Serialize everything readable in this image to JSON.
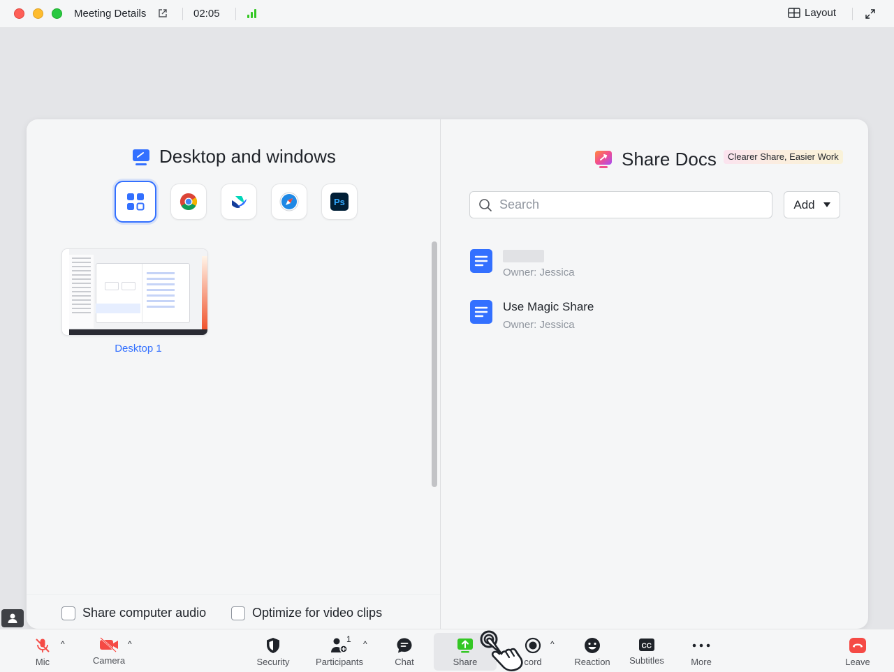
{
  "titlebar": {
    "meeting_title": "Meeting Details",
    "timer": "02:05",
    "layout_label": "Layout"
  },
  "left_panel": {
    "title": "Desktop and windows",
    "apps": [
      "all-windows-icon",
      "chrome-icon",
      "feishu-icon",
      "safari-icon",
      "photoshop-icon"
    ],
    "desktop_label": "Desktop 1",
    "share_audio_label": "Share computer audio",
    "optimize_video_label": "Optimize for video clips"
  },
  "right_panel": {
    "title": "Share Docs",
    "tagline": "Clearer Share, Easier Work",
    "search_placeholder": "Search",
    "add_label": "Add",
    "docs": [
      {
        "title": "",
        "owner": "Owner: Jessica"
      },
      {
        "title": "Use Magic Share",
        "owner": "Owner: Jessica"
      }
    ]
  },
  "toolbar": {
    "mic": "Mic",
    "camera": "Camera",
    "security": "Security",
    "participants": "Participants",
    "participants_count": "1",
    "chat": "Chat",
    "share": "Share",
    "record": "cord",
    "reaction": "Reaction",
    "subtitles": "Subtitles",
    "more": "More",
    "leave": "Leave"
  },
  "colors": {
    "accent": "#3370ff",
    "danger": "#f54a45",
    "share_green": "#34c724"
  }
}
